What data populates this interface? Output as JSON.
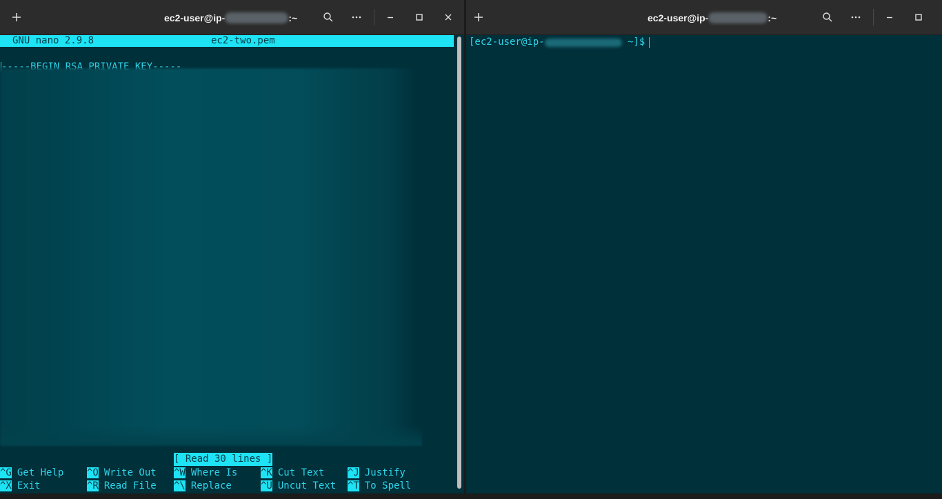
{
  "left_window": {
    "title_prefix": "ec2-user@ip-",
    "title_suffix": ":~",
    "icons": [
      "plus-icon",
      "search-icon",
      "more-icon",
      "minimize-icon",
      "maximize-icon",
      "close-icon"
    ]
  },
  "right_window": {
    "title_prefix": "ec2-user@ip-",
    "title_suffix": ":~",
    "icons": [
      "plus-icon",
      "search-icon",
      "more-icon",
      "minimize-icon",
      "maximize-icon"
    ]
  },
  "nano": {
    "version": "GNU nano 2.9.8",
    "filename": "ec2-two.pem",
    "first_line": "-----BEGIN RSA PRIVATE KEY-----",
    "status": "[ Read 30 lines ]",
    "shortcuts_row1": [
      {
        "key": "^G",
        "label": "Get Help"
      },
      {
        "key": "^O",
        "label": "Write Out"
      },
      {
        "key": "^W",
        "label": "Where Is"
      },
      {
        "key": "^K",
        "label": "Cut Text"
      },
      {
        "key": "^J",
        "label": "Justify"
      }
    ],
    "shortcuts_row2": [
      {
        "key": "^X",
        "label": "Exit"
      },
      {
        "key": "^R",
        "label": "Read File"
      },
      {
        "key": "^\\",
        "label": "Replace"
      },
      {
        "key": "^U",
        "label": "Uncut Text"
      },
      {
        "key": "^T",
        "label": "To Spell"
      }
    ]
  },
  "shell": {
    "prompt_prefix": "[ec2-user@ip-",
    "prompt_suffix": " ~]$"
  },
  "colors": {
    "terminal_bg": "#00303a",
    "text": "#2ed4e8",
    "highlight": "#1ee3f5",
    "titlebar": "#2c2c2c"
  }
}
